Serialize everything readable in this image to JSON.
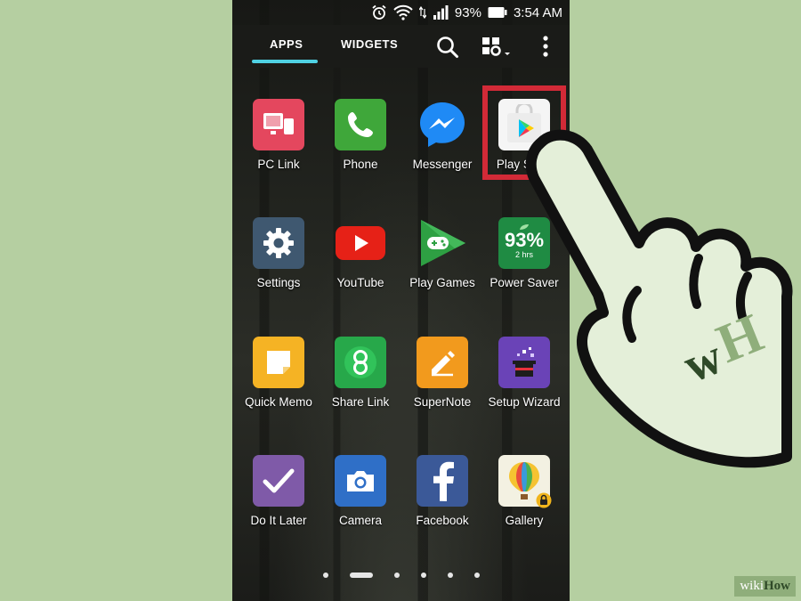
{
  "status": {
    "battery": "93%",
    "time": "3:54 AM"
  },
  "header": {
    "tabs": [
      {
        "label": "APPS",
        "selected": true
      },
      {
        "label": "WIDGETS",
        "selected": false
      }
    ]
  },
  "apps": [
    {
      "label": "PC Link",
      "icon": "pc-link-icon",
      "color": "#e4475e"
    },
    {
      "label": "Phone",
      "icon": "phone-icon",
      "color": "#3fa73a"
    },
    {
      "label": "Messenger",
      "icon": "messenger-icon",
      "color": "#1f8af5"
    },
    {
      "label": "Play Store",
      "icon": "play-store-icon",
      "color": "#f5f5f5"
    },
    {
      "label": "Settings",
      "icon": "settings-gear-icon",
      "color": "#3f5870"
    },
    {
      "label": "YouTube",
      "icon": "youtube-icon",
      "color": "#e62117"
    },
    {
      "label": "Play Games",
      "icon": "play-games-icon",
      "color": "#2ea043"
    },
    {
      "label": "Power Saver",
      "icon": "power-saver-icon",
      "color": "#1f8b43",
      "battery_text": "93%",
      "sub_text": "2 hrs"
    },
    {
      "label": "Quick Memo",
      "icon": "quick-memo-icon",
      "color": "#f5b324"
    },
    {
      "label": "Share Link",
      "icon": "share-link-icon",
      "color": "#27a84a"
    },
    {
      "label": "SuperNote",
      "icon": "supernote-icon",
      "color": "#f29a1d"
    },
    {
      "label": "Setup Wizard",
      "icon": "setup-wizard-icon",
      "color": "#6a43b7"
    },
    {
      "label": "Do It Later",
      "icon": "do-it-later-icon",
      "color": "#7f5aa8"
    },
    {
      "label": "Camera",
      "icon": "camera-icon",
      "color": "#2f6fc7"
    },
    {
      "label": "Facebook",
      "icon": "facebook-icon",
      "color": "#3b5998"
    },
    {
      "label": "Gallery",
      "icon": "gallery-icon",
      "color": "#f3f1e2"
    }
  ],
  "pager": {
    "pages": 6,
    "active_index": 1
  },
  "watermark": {
    "wiki": "wiki",
    "how": "How"
  }
}
